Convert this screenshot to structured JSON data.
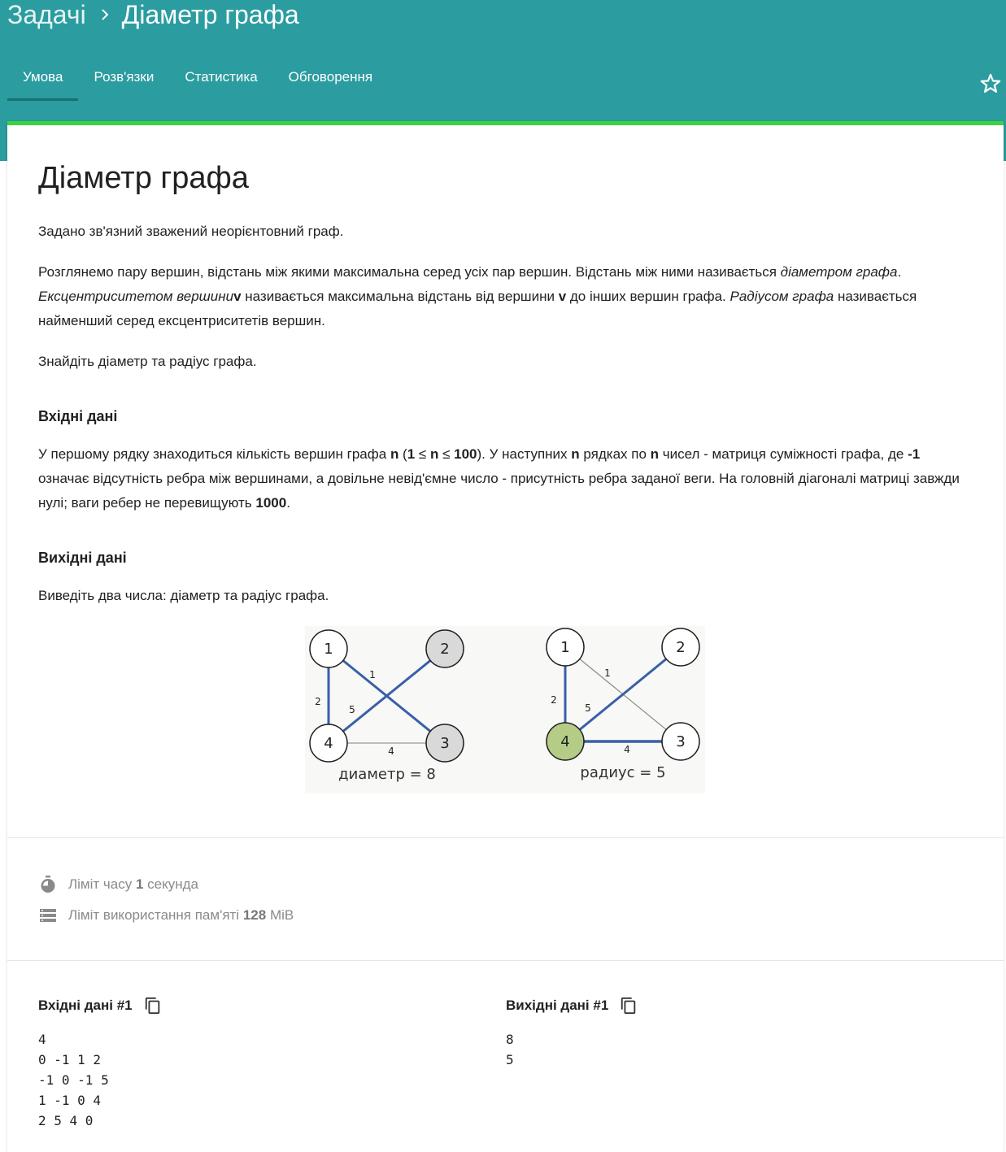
{
  "breadcrumb": {
    "root": "Задачі",
    "current": "Діаметр графа"
  },
  "tabs": [
    {
      "label": "Умова",
      "active": true
    },
    {
      "label": "Розв'язки",
      "active": false
    },
    {
      "label": "Статистика",
      "active": false
    },
    {
      "label": "Обговорення",
      "active": false
    }
  ],
  "colors": {
    "header": "#2b9c9f",
    "accent_bar": "#39d43e",
    "edge_blue": "#3a5fa8",
    "center_node": "#b5cc86",
    "far_node": "#d9d9d9"
  },
  "problem": {
    "title": "Діаметр графа",
    "p1": "Задано зв'язний зважений неорієнтовний граф.",
    "p2": {
      "a": "Розглянемо пару вершин, відстань між якими максимальна серед усіх пар вершин. Відстань між ними називається ",
      "b": "діаметром графа",
      "c": ". ",
      "d": "Ексцентриситетом вершини",
      "e": "v",
      "f": " називається максимальна відстань від вершини ",
      "g": "v",
      "h": " до інших вершин графа. ",
      "i": "Радіусом графа",
      "j": " називається найменший серед ексцентриситетів вершин."
    },
    "p3": "Знайдіть діаметр та радіус графа.",
    "input_heading": "Вхідні дані",
    "input": {
      "a": "У першому рядку знаходиться кількість вершин графа ",
      "b": "n",
      "c": " (",
      "d": "1",
      "e": " ≤ ",
      "f": "n",
      "g": " ≤ ",
      "h": "100",
      "i": "). У наступних ",
      "j": "n",
      "k": " рядках по ",
      "l": "n",
      "m": " чисел - матриця суміжності графа, де ",
      "n": "-1",
      "o": " означає відсутність ребра між вершинами, а довільне невід'ємне число - присутність ребра заданої веги. На головній діагоналі матриці завжди нулі; ваги ребер не перевищують ",
      "p": "1000",
      "q": "."
    },
    "output_heading": "Вихідні дані",
    "output": "Виведіть два числа: діаметр та радіус графа."
  },
  "figure": {
    "nodes": [
      "1",
      "2",
      "3",
      "4"
    ],
    "edge_weights": [
      "1",
      "2",
      "5",
      "4"
    ],
    "left_caption": "диаметр = 8",
    "right_caption": "радиус = 5"
  },
  "limits": {
    "time_prefix": "Ліміт часу",
    "time_value": "1",
    "time_unit": "секунда",
    "memory_prefix": "Ліміт використання пам'яті",
    "memory_value": "128",
    "memory_unit": "MiB"
  },
  "examples": {
    "input_label": "Вхідні дані #1",
    "output_label": "Вихідні дані #1",
    "input_text": "4\n0 -1 1 2\n-1 0 -1 5\n1 -1 0 4\n2 5 4 0",
    "output_text": "8\n5"
  },
  "icons": {
    "breadcrumb_sep": "chevron-right-icon",
    "favorite": "star-outline-icon",
    "time": "timer-icon",
    "memory": "storage-icon",
    "copy": "copy-icon"
  }
}
